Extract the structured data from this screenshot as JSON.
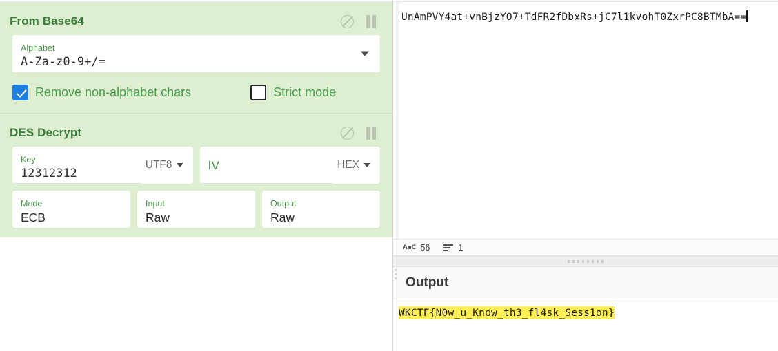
{
  "recipe": {
    "operations": [
      {
        "title": "From Base64",
        "disable_icon": "disable-icon",
        "pause_icon": "pause-icon",
        "args": {
          "alphabet_label": "Alphabet",
          "alphabet_value": "A-Za-z0-9+/=",
          "remove_non_alphabet_label": "Remove non-alphabet chars",
          "remove_non_alphabet_checked": true,
          "strict_mode_label": "Strict mode",
          "strict_mode_checked": false
        }
      },
      {
        "title": "DES Decrypt",
        "disable_icon": "disable-icon",
        "pause_icon": "pause-icon",
        "args": {
          "key_label": "Key",
          "key_value": "12312312",
          "key_encoding": "UTF8",
          "iv_label": "IV",
          "iv_value": "",
          "iv_encoding": "HEX",
          "mode_label": "Mode",
          "mode_value": "ECB",
          "input_label": "Input",
          "input_value": "Raw",
          "output_label": "Output",
          "output_value": "Raw"
        }
      }
    ]
  },
  "input": {
    "text": "UnAmPVY4at+vnBjzYO7+TdFR2fDbxRs+jC7l1kvohT0ZxrPC8BTMbA==",
    "status": {
      "chars_icon": "abc-icon",
      "chars_count": "56",
      "lines_icon": "lines-icon",
      "lines_count": "1"
    }
  },
  "output": {
    "title": "Output",
    "text": "WKCTF{N0w_u_Know_th3_fl4sk_Sess1on}"
  },
  "colors": {
    "recipe_bg": "#ddeed1",
    "op_title": "#3a7d3a",
    "label_green": "#4f9a4f",
    "checkbox_accent": "#1f7fe0",
    "highlight": "#ffee55"
  }
}
